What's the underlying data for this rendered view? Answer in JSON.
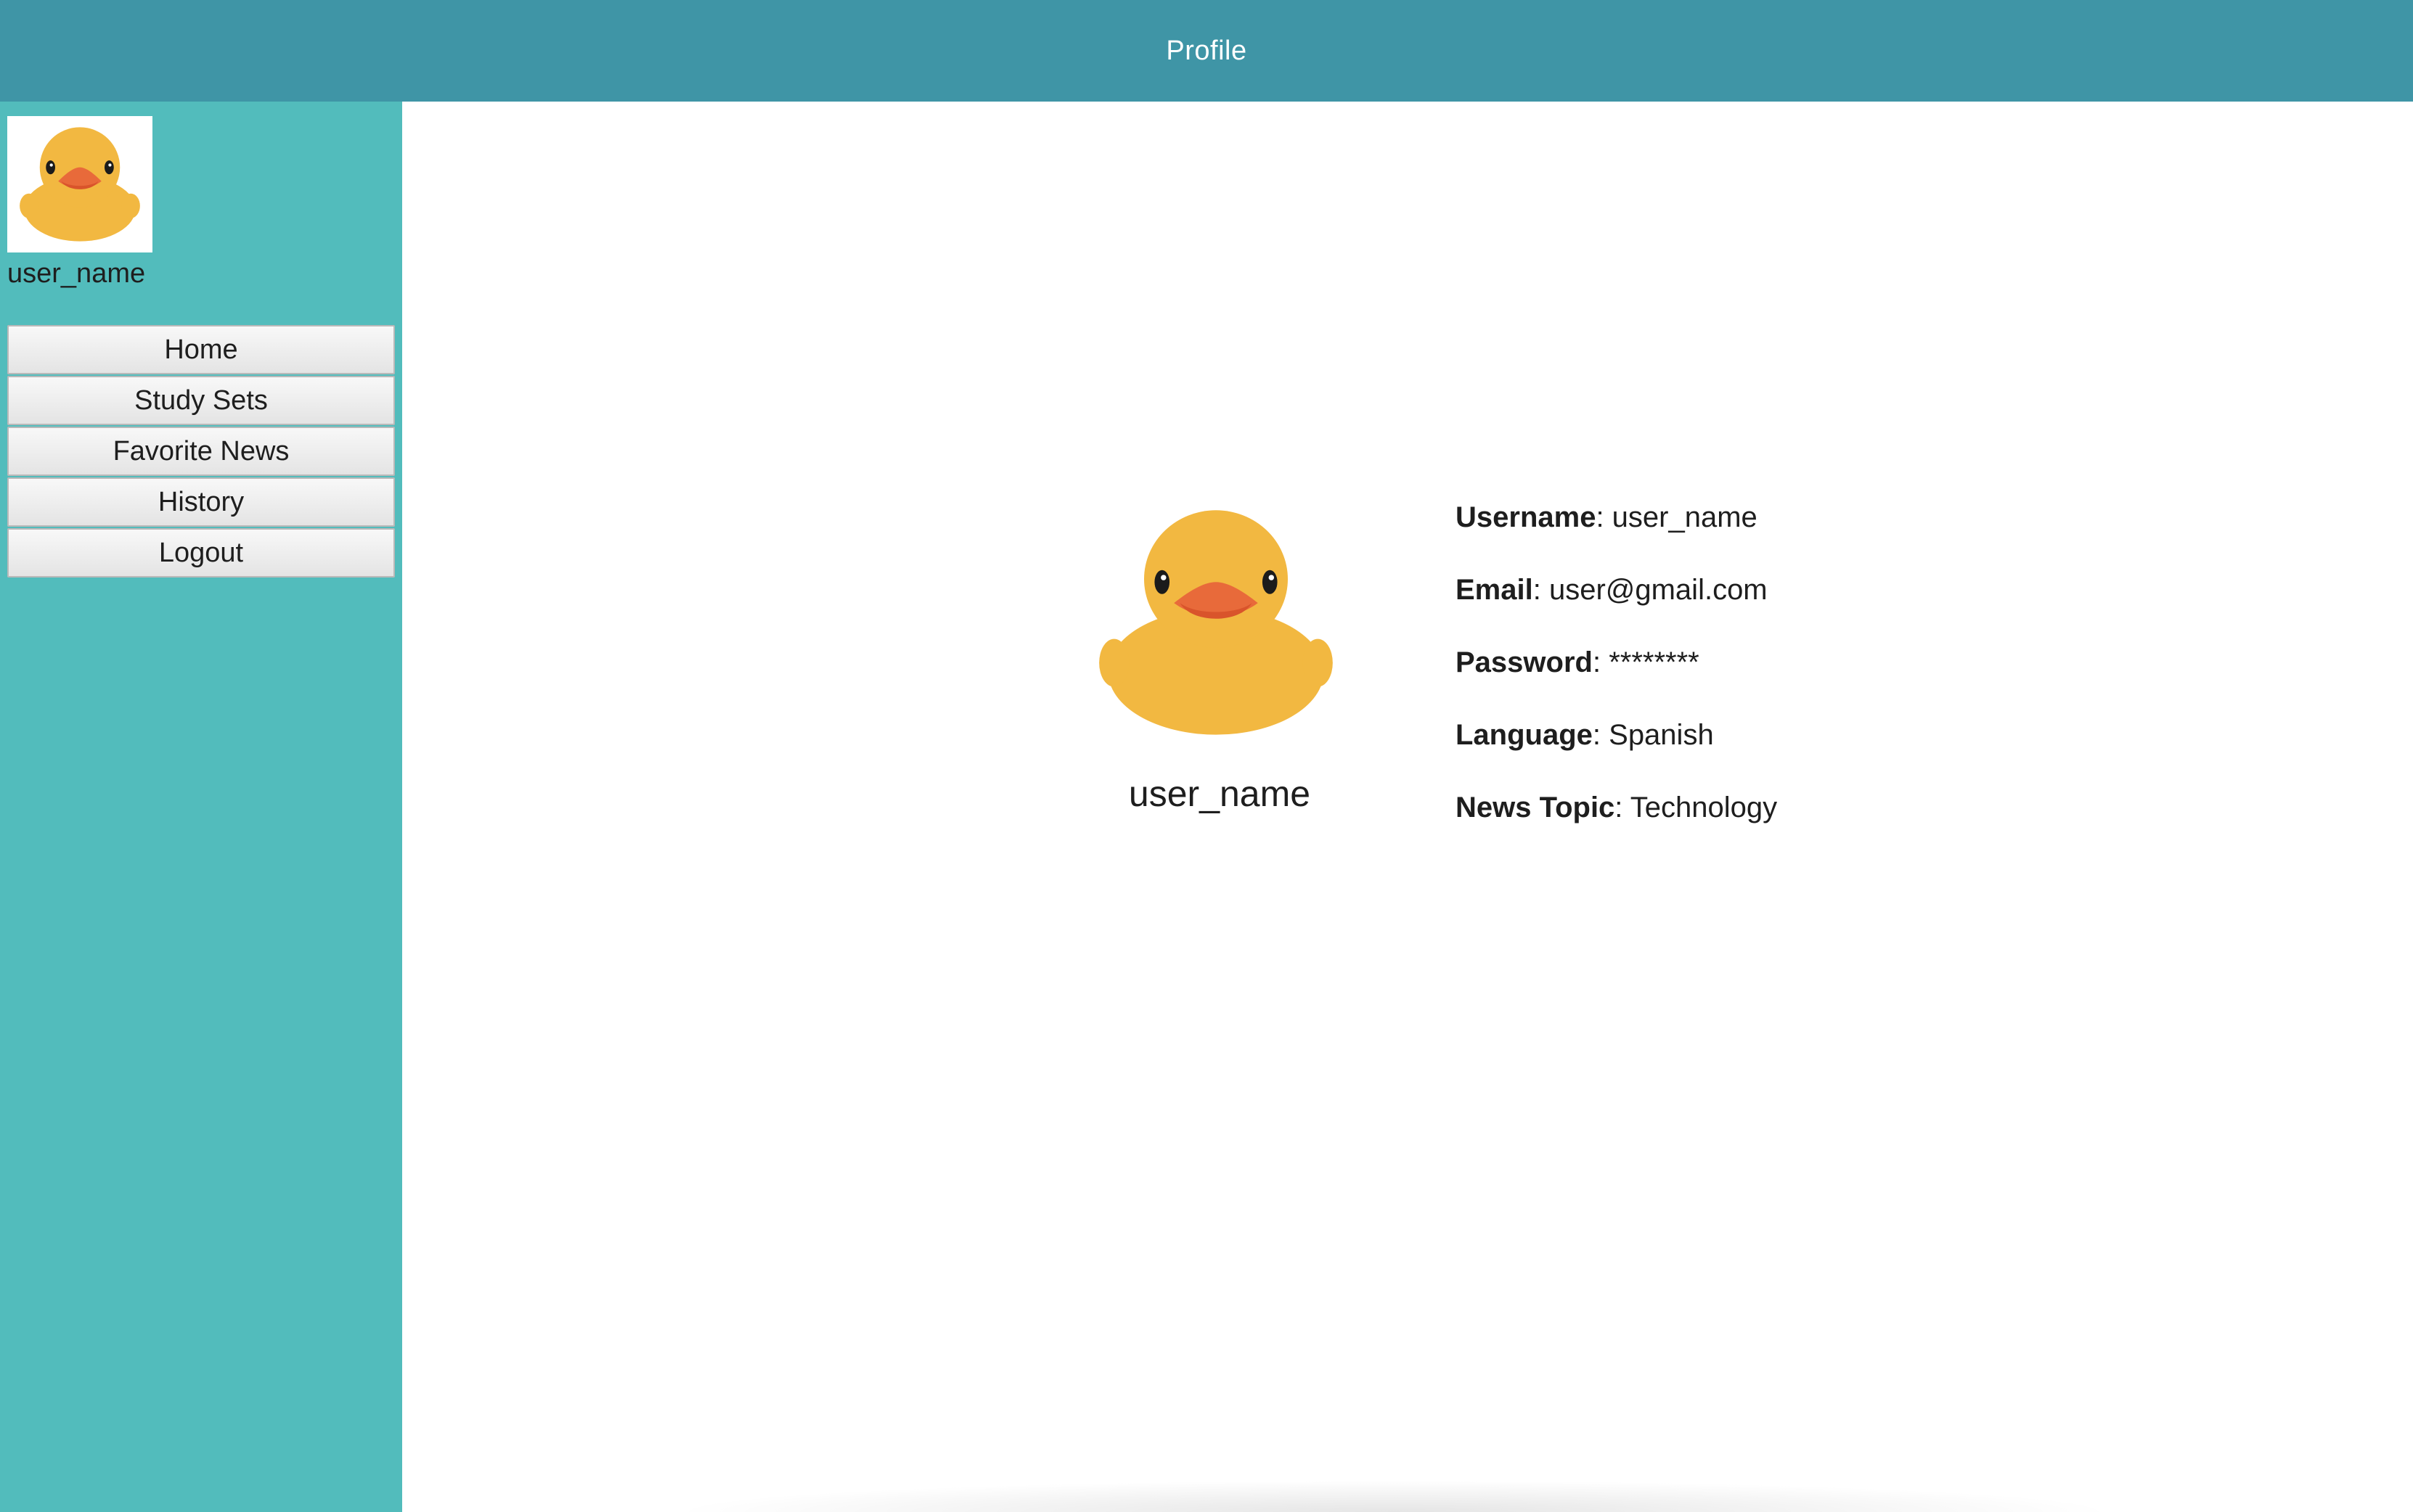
{
  "header": {
    "title": "Profile"
  },
  "sidebar": {
    "avatar_icon": "rubber-duck-icon",
    "username": "user_name",
    "nav": [
      {
        "label": "Home"
      },
      {
        "label": "Study Sets"
      },
      {
        "label": "Favorite News"
      },
      {
        "label": "History"
      },
      {
        "label": "Logout"
      }
    ]
  },
  "profile": {
    "avatar_icon": "rubber-duck-icon",
    "display_name": "user_name",
    "details": [
      {
        "key": "Username",
        "value": ": user_name"
      },
      {
        "key": "Email",
        "value": ": user@gmail.com"
      },
      {
        "key": "Password",
        "value": ": ********"
      },
      {
        "key": "Language",
        "value": ": Spanish"
      },
      {
        "key": "News Topic",
        "value": ": Technology"
      }
    ]
  },
  "colors": {
    "header_bg": "#3f95a6",
    "sidebar_bg": "#52bcbc",
    "duck_body": "#f2b841",
    "duck_beak": "#e86a3a"
  }
}
